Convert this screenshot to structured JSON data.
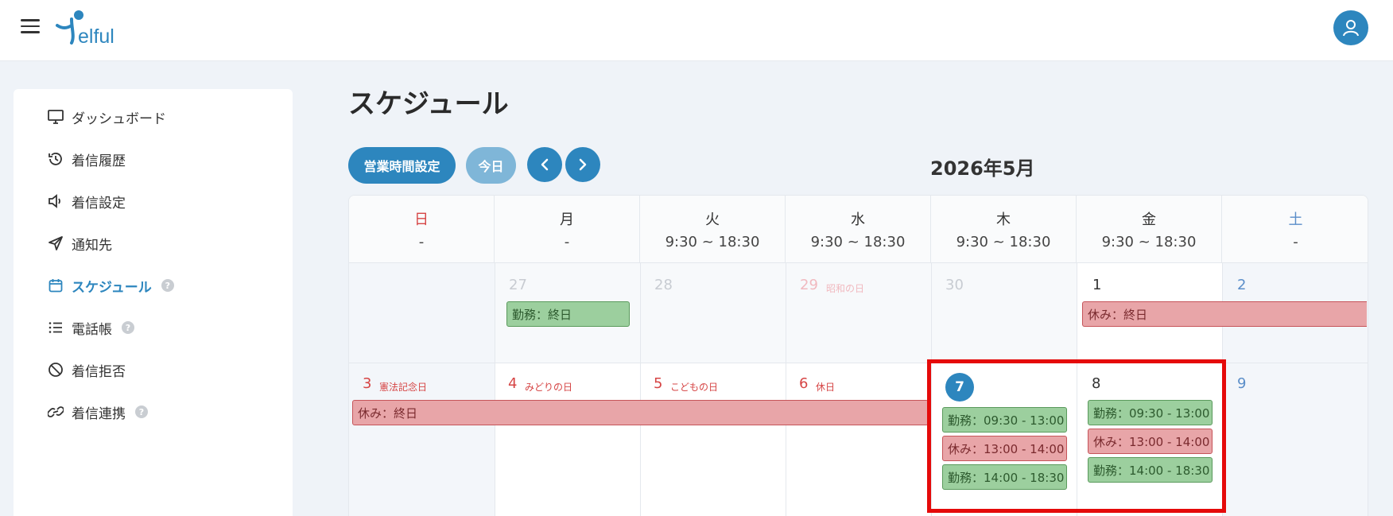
{
  "header": {
    "logo_text": "elful",
    "menu_icon": "hamburger-icon",
    "user_icon": "user-icon"
  },
  "sidebar": {
    "items": [
      {
        "label": "ダッシュボード",
        "icon": "monitor-icon"
      },
      {
        "label": "着信履歴",
        "icon": "history-icon"
      },
      {
        "label": "着信設定",
        "icon": "speaker-icon"
      },
      {
        "label": "通知先",
        "icon": "send-icon"
      },
      {
        "label": "スケジュール",
        "icon": "calendar-icon",
        "active": true,
        "help": "?"
      },
      {
        "label": "電話帳",
        "icon": "list-icon",
        "help": "?"
      },
      {
        "label": "着信拒否",
        "icon": "block-icon"
      },
      {
        "label": "着信連携",
        "icon": "link-icon",
        "help": "?"
      }
    ]
  },
  "main": {
    "title": "スケジュール",
    "buttons": {
      "business_hours": "営業時間設定",
      "today": "今日"
    },
    "month": "2026年5月"
  },
  "calendar": {
    "weekdays": [
      {
        "day": "日",
        "hours": "-"
      },
      {
        "day": "月",
        "hours": "-"
      },
      {
        "day": "火",
        "hours": "9:30 ~ 18:30"
      },
      {
        "day": "水",
        "hours": "9:30 ~ 18:30"
      },
      {
        "day": "木",
        "hours": "9:30 ~ 18:30"
      },
      {
        "day": "金",
        "hours": "9:30 ~ 18:30"
      },
      {
        "day": "土",
        "hours": "-"
      }
    ],
    "week1": {
      "dates": [
        "27",
        "28",
        "29",
        "30",
        "1",
        "2"
      ],
      "holiday_29": "昭和の日",
      "events": {
        "mon": "勤務：終日",
        "fri_sat": "休み：終日"
      }
    },
    "week2": {
      "dates": [
        "3",
        "4",
        "5",
        "6",
        "7",
        "8",
        "9"
      ],
      "holidays": [
        "憲法記念日",
        "みどりの日",
        "こどもの日",
        "休日"
      ],
      "span_event": "休み：終日",
      "thu_events": [
        "勤務：09:30 - 13:00",
        "休み：13:00 - 14:00",
        "勤務：14:00 - 18:30"
      ],
      "fri_events": [
        "勤務：09:30 - 13:00",
        "休み：13:00 - 14:00",
        "勤務：14:00 - 18:30"
      ]
    }
  },
  "colors": {
    "primary": "#2d86be",
    "work_green": "#9ccf9e",
    "rest_red": "#e8a5a8",
    "highlight": "#e50a0a"
  }
}
